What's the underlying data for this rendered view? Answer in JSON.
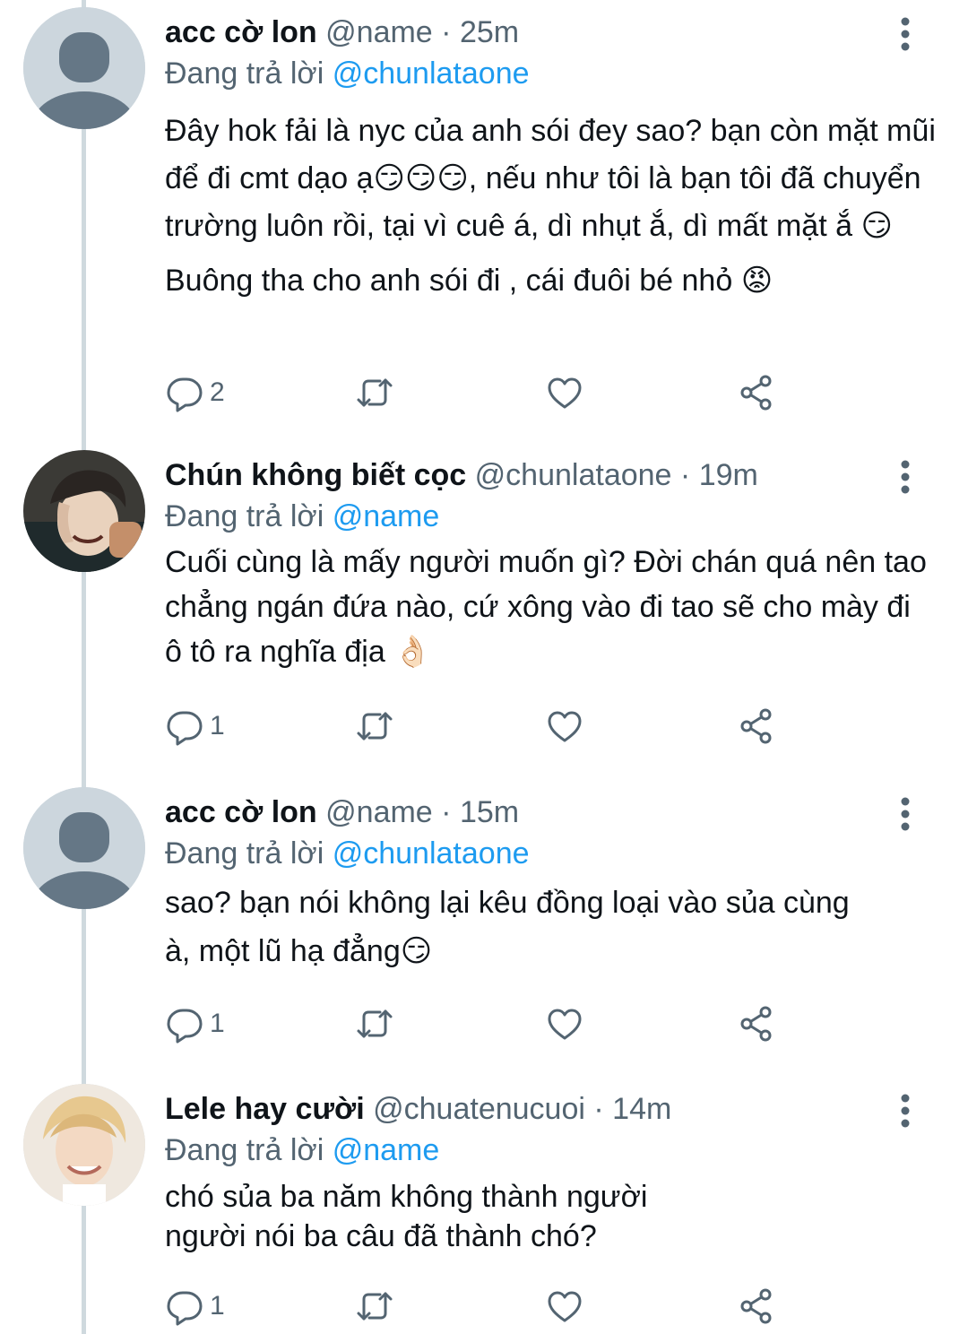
{
  "tweets": [
    {
      "display_name": "acc cờ lon",
      "handle": "@name",
      "sep": "·",
      "time": "25m",
      "replying_label": "Đang trả lời",
      "replying_to": "@chunlataone",
      "paragraphs": [
        "Đây hok fải là nyc của anh sói đey sao? bạn còn mặt mũi để đi cmt dạo ạ😏😏😏, nếu như tôi là bạn tôi đã chuyển trường luôn rồi, tại vì cuê á, dì nhụt ắ, dì mất mặt ắ 😏",
        "Buông tha cho anh sói đi , cái đuôi bé nhỏ 😡"
      ],
      "reply_count": "2",
      "avatar": "default-avatar"
    },
    {
      "display_name": "Chún không biết cọc",
      "handle": "@chunlataone",
      "sep": "·",
      "time": "19m",
      "replying_label": "Đang trả lời",
      "replying_to": "@name",
      "paragraphs": [
        "Cuối cùng là mấy người muốn gì? Đời chán quá nên tao chẳng ngán đứa nào, cứ xông vào đi tao sẽ cho mày đi ô tô ra nghĩa địa 👌🏻"
      ],
      "reply_count": "1",
      "avatar": "photo-avatar-dark"
    },
    {
      "display_name": "acc cờ lon",
      "handle": "@name",
      "sep": "·",
      "time": "15m",
      "replying_label": "Đang trả lời",
      "replying_to": "@chunlataone",
      "paragraphs": [
        "sao? bạn nói không lại kêu đồng loại vào sủa cùng  à, một lũ hạ đẳng😏"
      ],
      "reply_count": "1",
      "avatar": "default-avatar"
    },
    {
      "display_name": "Lele hay cười",
      "handle": "@chuatenucuoi",
      "sep": "·",
      "time": "14m",
      "replying_label": "Đang trả lời",
      "replying_to": "@name",
      "paragraphs": [
        "chó sủa ba năm không thành người",
        "người nói ba câu đã thành chó?"
      ],
      "reply_count": "1",
      "avatar": "photo-avatar-light"
    }
  ],
  "colors": {
    "text": "#0f1419",
    "secondary": "#536471",
    "link": "#1d9bf0",
    "thread_line": "#cfd9de",
    "default_avatar_bg": "#ccd6dd",
    "default_avatar_fg": "#657786"
  },
  "icons": {
    "more": "more-vertical-icon",
    "reply": "reply-bubble-icon",
    "retweet": "retweet-icon",
    "like": "heart-icon",
    "share": "share-icon"
  }
}
